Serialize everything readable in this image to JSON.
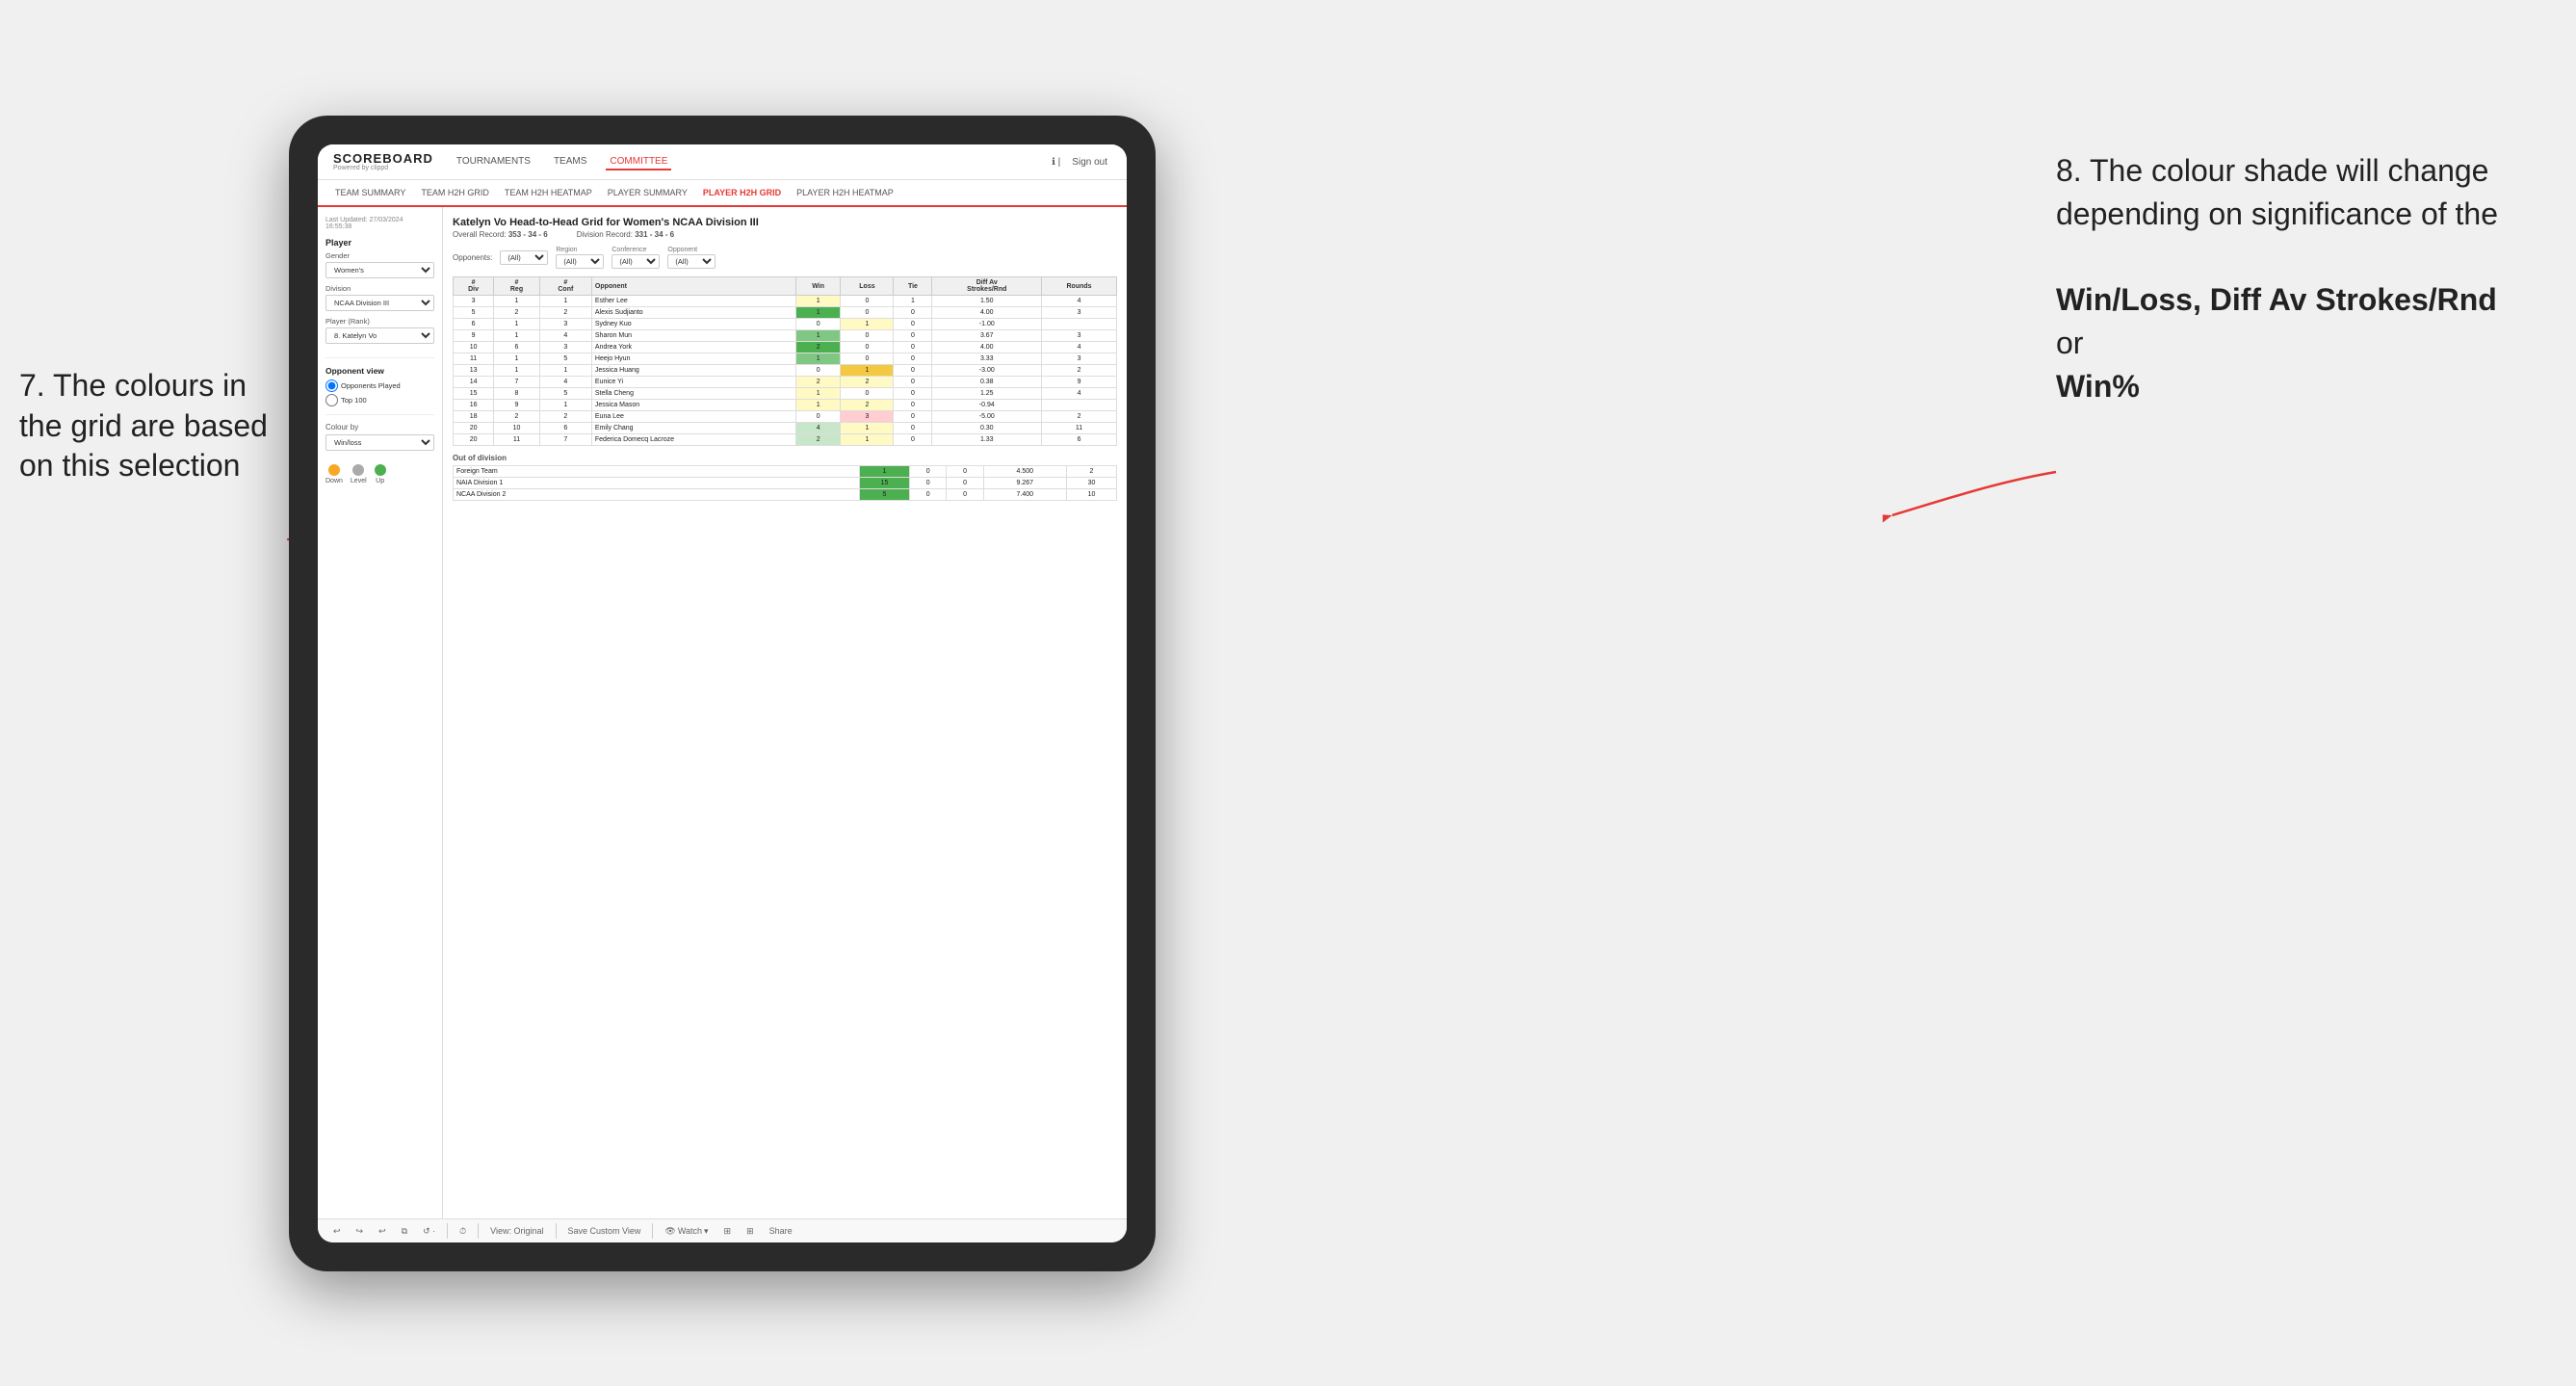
{
  "annotations": {
    "left_title": "7. The colours in the grid are based on this selection",
    "right_title": "8. The colour shade will change depending on significance of the",
    "right_bold1": "Win/Loss,",
    "right_bold2": "Diff Av Strokes/Rnd",
    "right_or": "or",
    "right_bold3": "Win%"
  },
  "nav": {
    "logo_main": "SCOREBOARD",
    "logo_sub": "Powered by clippd",
    "links": [
      "TOURNAMENTS",
      "TEAMS",
      "COMMITTEE"
    ],
    "active_link": "COMMITTEE",
    "sign_out": "Sign out"
  },
  "sub_nav": {
    "links": [
      "TEAM SUMMARY",
      "TEAM H2H GRID",
      "TEAM H2H HEATMAP",
      "PLAYER SUMMARY",
      "PLAYER H2H GRID",
      "PLAYER H2H HEATMAP"
    ],
    "active": "PLAYER H2H GRID"
  },
  "sidebar": {
    "timestamp": "Last Updated: 27/03/2024",
    "timestamp2": "16:55:38",
    "player_section": "Player",
    "gender_label": "Gender",
    "gender_value": "Women's",
    "division_label": "Division",
    "division_value": "NCAA Division III",
    "player_rank_label": "Player (Rank)",
    "player_rank_value": "8. Katelyn Vo",
    "opponent_view_title": "Opponent view",
    "radio1": "Opponents Played",
    "radio2": "Top 100",
    "colour_by_label": "Colour by",
    "colour_by_value": "Win/loss",
    "legend_down": "Down",
    "legend_level": "Level",
    "legend_up": "Up"
  },
  "grid": {
    "title": "Katelyn Vo Head-to-Head Grid for Women's NCAA Division III",
    "overall_record_label": "Overall Record:",
    "overall_record": "353 - 34 - 6",
    "division_record_label": "Division Record:",
    "division_record": "331 - 34 - 6",
    "filter_opponents_label": "Opponents:",
    "filter_opponents_value": "(All)",
    "filter_region_label": "Region",
    "filter_region_value": "(All)",
    "filter_conference_label": "Conference",
    "filter_conference_value": "(All)",
    "filter_opponent_label": "Opponent",
    "filter_opponent_value": "(All)",
    "col_headers": [
      "#\nDiv",
      "#\nReg",
      "#\nConf",
      "Opponent",
      "Win",
      "Loss",
      "Tie",
      "Diff Av\nStrokes/Rnd",
      "Rounds"
    ],
    "rows": [
      {
        "div": 3,
        "reg": 1,
        "conf": 1,
        "name": "Esther Lee",
        "win": 1,
        "loss": 0,
        "tie": 1,
        "diff": 1.5,
        "rounds": 4,
        "win_color": "yellow",
        "loss_color": "white"
      },
      {
        "div": 5,
        "reg": 2,
        "conf": 2,
        "name": "Alexis Sudjianto",
        "win": 1,
        "loss": 0,
        "tie": 0,
        "diff": 4.0,
        "rounds": 3,
        "win_color": "green-dark",
        "loss_color": "white"
      },
      {
        "div": 6,
        "reg": 1,
        "conf": 3,
        "name": "Sydney Kuo",
        "win": 0,
        "loss": 1,
        "tie": 0,
        "diff": -1.0,
        "rounds": "",
        "win_color": "white",
        "loss_color": "yellow"
      },
      {
        "div": 9,
        "reg": 1,
        "conf": 4,
        "name": "Sharon Mun",
        "win": 1,
        "loss": 0,
        "tie": 0,
        "diff": 3.67,
        "rounds": 3,
        "win_color": "green-medium",
        "loss_color": "white"
      },
      {
        "div": 10,
        "reg": 6,
        "conf": 3,
        "name": "Andrea York",
        "win": 2,
        "loss": 0,
        "tie": 0,
        "diff": 4.0,
        "rounds": 4,
        "win_color": "green-dark",
        "loss_color": "white"
      },
      {
        "div": 11,
        "reg": 1,
        "conf": 5,
        "name": "Heejo Hyun",
        "win": 1,
        "loss": 0,
        "tie": 0,
        "diff": 3.33,
        "rounds": 3,
        "win_color": "green-medium",
        "loss_color": "white"
      },
      {
        "div": 13,
        "reg": 1,
        "conf": 1,
        "name": "Jessica Huang",
        "win": 0,
        "loss": 1,
        "tie": 0,
        "diff": -3.0,
        "rounds": 2,
        "win_color": "white",
        "loss_color": "yellow-dark"
      },
      {
        "div": 14,
        "reg": 7,
        "conf": 4,
        "name": "Eunice Yi",
        "win": 2,
        "loss": 2,
        "tie": 0,
        "diff": 0.38,
        "rounds": 9,
        "win_color": "yellow-light",
        "loss_color": "yellow-light"
      },
      {
        "div": 15,
        "reg": 8,
        "conf": 5,
        "name": "Stella Cheng",
        "win": 1,
        "loss": 0,
        "tie": 0,
        "diff": 1.25,
        "rounds": 4,
        "win_color": "yellow",
        "loss_color": "white"
      },
      {
        "div": 16,
        "reg": 9,
        "conf": 1,
        "name": "Jessica Mason",
        "win": 1,
        "loss": 2,
        "tie": 0,
        "diff": -0.94,
        "rounds": "",
        "win_color": "yellow-light",
        "loss_color": "yellow"
      },
      {
        "div": 18,
        "reg": 2,
        "conf": 2,
        "name": "Euna Lee",
        "win": 0,
        "loss": 3,
        "tie": 0,
        "diff": -5.0,
        "rounds": 2,
        "win_color": "white",
        "loss_color": "red-light"
      },
      {
        "div": 20,
        "reg": 10,
        "conf": 6,
        "name": "Emily Chang",
        "win": 4,
        "loss": 1,
        "tie": 0,
        "diff": 0.3,
        "rounds": 11,
        "win_color": "green-light",
        "loss_color": "yellow-light"
      },
      {
        "div": 20,
        "reg": 11,
        "conf": 7,
        "name": "Federica Domecq Lacroze",
        "win": 2,
        "loss": 1,
        "tie": 0,
        "diff": 1.33,
        "rounds": 6,
        "win_color": "green-light",
        "loss_color": "yellow-light"
      }
    ],
    "out_of_division_label": "Out of division",
    "out_of_division_rows": [
      {
        "name": "Foreign Team",
        "win": 1,
        "loss": 0,
        "tie": 0,
        "diff": 4.5,
        "rounds": 2,
        "win_color": "green-dark"
      },
      {
        "name": "NAIA Division 1",
        "win": 15,
        "loss": 0,
        "tie": 0,
        "diff": 9.267,
        "rounds": 30,
        "win_color": "green-dark"
      },
      {
        "name": "NCAA Division 2",
        "win": 5,
        "loss": 0,
        "tie": 0,
        "diff": 7.4,
        "rounds": 10,
        "win_color": "green-dark"
      }
    ]
  },
  "toolbar": {
    "view_original": "View: Original",
    "save_custom_view": "Save Custom View",
    "watch": "Watch",
    "share": "Share"
  }
}
